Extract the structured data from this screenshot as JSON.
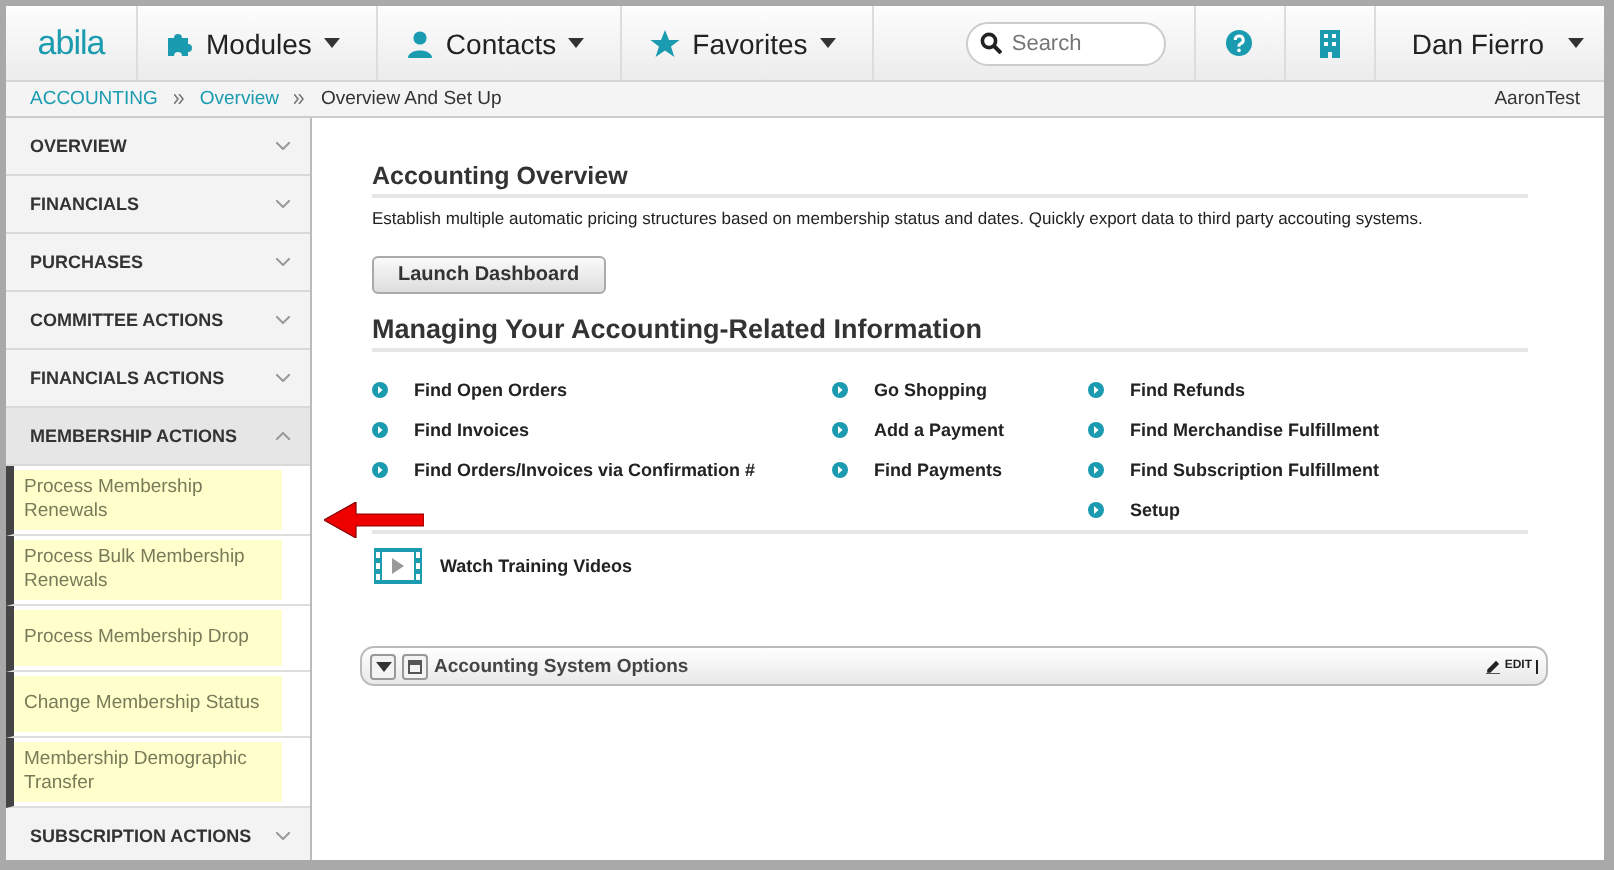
{
  "logo": "abila",
  "nav": [
    {
      "label": "Modules",
      "kind": "modules"
    },
    {
      "label": "Contacts",
      "kind": "contacts"
    },
    {
      "label": "Favorites",
      "kind": "favorites"
    }
  ],
  "search": {
    "placeholder": "Search"
  },
  "user": "Dan Fierro",
  "breadcrumb": [
    {
      "label": "ACCOUNTING",
      "link": true
    },
    {
      "label": "Overview",
      "link": true
    },
    {
      "label": "Overview And Set Up",
      "link": false
    }
  ],
  "account": "AaronTest",
  "sidebar": [
    {
      "label": "OVERVIEW",
      "expanded": false
    },
    {
      "label": "FINANCIALS",
      "expanded": false
    },
    {
      "label": "PURCHASES",
      "expanded": false
    },
    {
      "label": "COMMITTEE ACTIONS",
      "expanded": false
    },
    {
      "label": "FINANCIALS ACTIONS",
      "expanded": false
    },
    {
      "label": "MEMBERSHIP ACTIONS",
      "expanded": true,
      "children": [
        {
          "label": "Process Membership Renewals",
          "highlighted": true
        },
        {
          "label": "Process Bulk Membership Renewals",
          "highlighted": true
        },
        {
          "label": "Process Membership Drop",
          "highlighted": true
        },
        {
          "label": "Change Membership Status",
          "highlighted": true
        },
        {
          "label": "Membership Demographic Transfer",
          "highlighted": true
        }
      ]
    },
    {
      "label": "SUBSCRIPTION ACTIONS",
      "expanded": false
    }
  ],
  "overview": {
    "title": "Accounting Overview",
    "description": "Establish multiple automatic pricing structures based on membership status and dates. Quickly export data to third party accouting systems.",
    "button": "Launch Dashboard"
  },
  "managing": {
    "title": "Managing Your Accounting-Related Information",
    "columns": [
      [
        "Find Open Orders",
        "Find Invoices",
        "Find Orders/Invoices via Confirmation #"
      ],
      [
        "Go Shopping",
        "Add a Payment",
        "Find Payments"
      ],
      [
        "Find Refunds",
        "Find Merchandise Fulfillment",
        "Find Subscription Fulfillment",
        "Setup"
      ]
    ]
  },
  "video_link": "Watch Training Videos",
  "panel": {
    "title": "Accounting System Options",
    "edit": "EDIT"
  }
}
